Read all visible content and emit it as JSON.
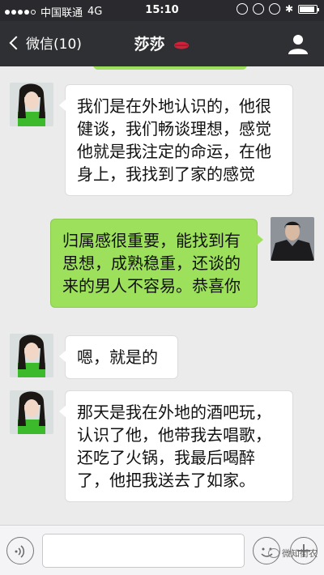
{
  "status_bar": {
    "carrier": "中国联通",
    "network": "4G",
    "time": "15:10"
  },
  "header": {
    "back_label": "微信(10)",
    "title": "莎莎",
    "title_emoji": "lips-icon",
    "right_icon": "person-icon"
  },
  "messages": [
    {
      "side": "in",
      "text": "我们是在外地认识的，他很健谈，我们畅谈理想，感觉他就是我注定的命运，在他身上，我找到了家的感觉"
    },
    {
      "side": "out",
      "text": "归属感很重要，能找到有思想，成熟稳重，还谈的来的男人不容易。恭喜你"
    },
    {
      "side": "in",
      "text": "嗯，就是的"
    },
    {
      "side": "in",
      "text": "那天是我在外地的酒吧玩，认识了他，他带我去唱歌，还吃了火锅，我最后喝醉了，他把我送去了如家。"
    }
  ],
  "input_bar": {
    "left_icon": "voice-icon",
    "mid_icon": "emoji-icon",
    "right_icon": "plus-icon",
    "watermark": "微知街农"
  },
  "colors": {
    "nav_bg": "#2f3033",
    "bubble_out": "#9de05c",
    "bubble_in": "#ffffff",
    "chat_bg": "#ebebeb"
  }
}
